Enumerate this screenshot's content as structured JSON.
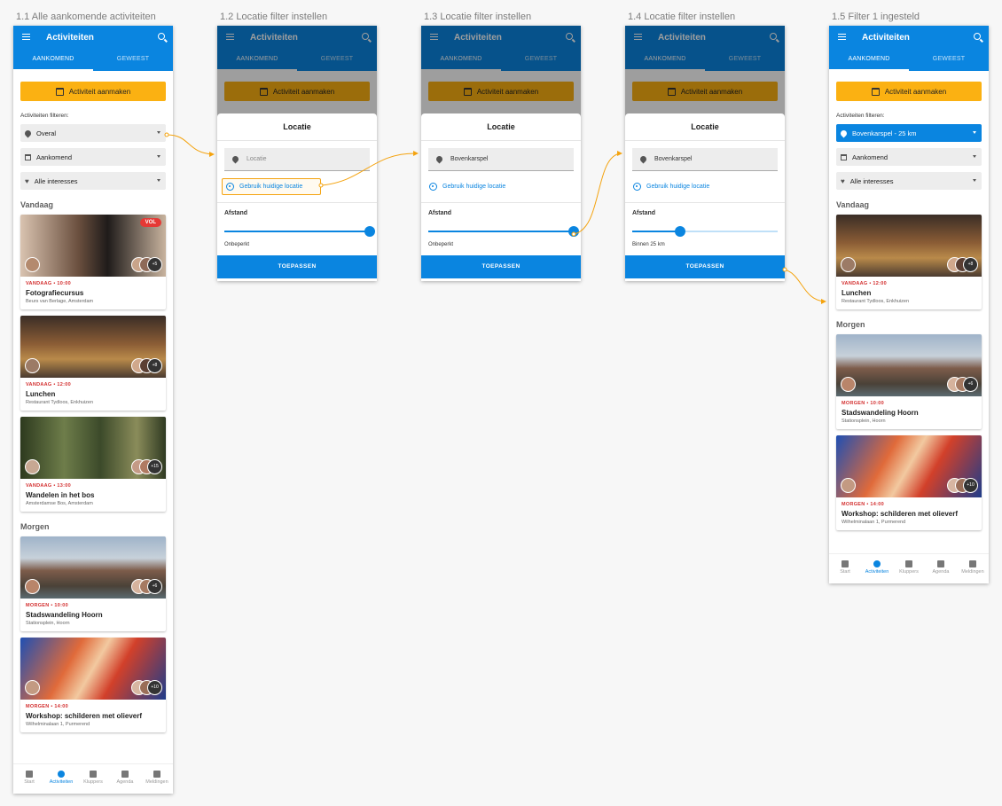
{
  "screens": [
    {
      "title": "1.1 Alle aankomende activiteiten"
    },
    {
      "title": "1.2 Locatie filter instellen"
    },
    {
      "title": "1.3 Locatie filter instellen"
    },
    {
      "title": "1.4 Locatie filter instellen"
    },
    {
      "title": "1.5 Filter 1 ingesteld"
    }
  ],
  "app": {
    "title": "Activiteiten",
    "tabs": [
      "AANKOMEND",
      "GEWEEST"
    ],
    "create_button": "Activiteit aanmaken",
    "filter_label": "Activiteiten filteren:",
    "filters": {
      "location": "Overal",
      "location_set": "Bovenkarspel - 25 km",
      "time": "Aankomend",
      "interests": "Alle interesses"
    },
    "sections": {
      "today": "Vandaag",
      "tomorrow": "Morgen"
    },
    "full_badge": "VOL",
    "nav": [
      "Start",
      "Activiteiten",
      "Kluppers",
      "Agenda",
      "Meldingen"
    ]
  },
  "activities": [
    {
      "meta": "VANDAAG • 10:00",
      "title": "Fotografiecursus",
      "location": "Beurs van Berlage, Amsterdam",
      "count": "+5"
    },
    {
      "meta": "VANDAAG • 12:00",
      "title": "Lunchen",
      "location": "Restaurant Tydloos, Enkhuizen",
      "count": "+8"
    },
    {
      "meta": "VANDAAG • 13:00",
      "title": "Wandelen in het bos",
      "location": "Amsterdamse Bos, Amsterdam",
      "count": "+15"
    },
    {
      "meta": "MORGEN • 10:00",
      "title": "Stadswandeling Hoorn",
      "location": "Stationsplein, Hoorn",
      "count": "+6"
    },
    {
      "meta": "MORGEN • 14:00",
      "title": "Workshop: schilderen met olieverf",
      "location": "Wilhelminalaan 1, Purmerend",
      "count": "+10"
    }
  ],
  "dialog": {
    "title": "Locatie",
    "placeholder": "Locatie",
    "value": "Bovenkarspel",
    "use_location": "Gebruik huidige locatie",
    "distance_label": "Afstand",
    "unlimited": "Onbeperkt",
    "within": "Binnen 25 km",
    "apply": "TOEPASSEN",
    "slider_unlimited": 1.0,
    "slider_25km": 0.33
  },
  "colors": {
    "primary": "#0a85e0",
    "accent": "#fbb112",
    "arrow": "#f4a30f",
    "date": "#d32f2f"
  }
}
